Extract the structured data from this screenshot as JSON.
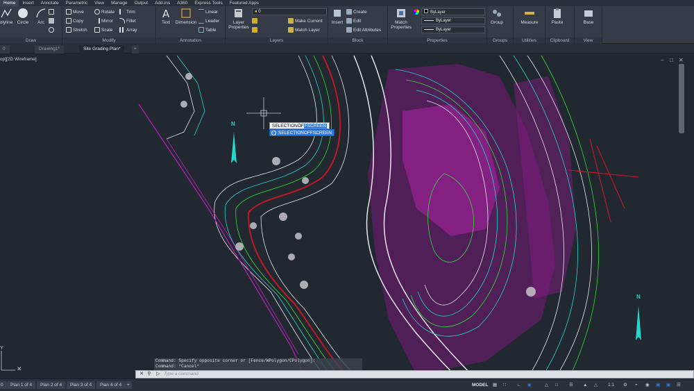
{
  "menu": [
    "Home",
    "Insert",
    "Annotate",
    "Parametric",
    "View",
    "Manage",
    "Output",
    "Add-ins",
    "A360",
    "Express Tools",
    "Featured Apps"
  ],
  "ribbon": {
    "draw": {
      "title": "Draw",
      "polyline": "olyline",
      "circle": "Circle",
      "arc": "Arc"
    },
    "modify": {
      "title": "Modify",
      "move": "Move",
      "rotate": "Rotate",
      "trim": "Trim",
      "copy": "Copy",
      "mirror": "Mirror",
      "fillet": "Fillet",
      "stretch": "Stretch",
      "scale": "Scale",
      "array": "Array"
    },
    "annotation": {
      "title": "Annotation",
      "text": "Text",
      "dimension": "Dimension",
      "linear": "Linear",
      "leader": "Leader",
      "table": "Table"
    },
    "layers": {
      "title": "Layers",
      "layer_properties": "Layer Properties",
      "layer_value": "0",
      "make_current": "Make Current",
      "match_layer": "Match Layer"
    },
    "block": {
      "title": "Block",
      "insert": "Insert",
      "create": "Create",
      "edit": "Edit",
      "edit_attributes": "Edit Attributes"
    },
    "properties": {
      "title": "Properties",
      "match_properties": "Match Properties",
      "bylayer1": "ByLayer",
      "bylayer2": "ByLayer",
      "bylayer3": "ByLayer"
    },
    "groups": {
      "title": "Groups",
      "group": "Group"
    },
    "utilities": {
      "title": "Utilities",
      "measure": "Measure"
    },
    "clipboard": {
      "title": "Clipboard",
      "paste": "Paste"
    },
    "view": {
      "title": "View",
      "base": "Base"
    }
  },
  "doc_tabs": {
    "first": "0",
    "drawing": "Drawing1*",
    "active": "Site Grading Plan*"
  },
  "viewport_label": "op][2D Wireframe]",
  "tooltip": {
    "prefix": "SELECTIONOF",
    "highlight": "FSCREEN",
    "suggestion": "SELECTIONOFFSCREEN"
  },
  "north_label": "N",
  "ucs_label": "Y",
  "command": {
    "history": [
      "Command: Specify opposite corner or [Fence/WPolygon/CPolygon]:",
      "Command: *Cancel*"
    ],
    "placeholder": "Type a command"
  },
  "layout_tabs": [
    "Plan 1 of 4",
    "Plan 2 of 4",
    "Plan 3 of 4",
    "Plan 4 of 4"
  ],
  "layout_first": "0",
  "status": {
    "model": "MODEL",
    "scale": "1:1"
  },
  "colors": {
    "magenta": "#c020c0",
    "green": "#2ee03a",
    "cyan": "#20d8d0",
    "white": "#e8e8f0",
    "red": "#c01828"
  }
}
